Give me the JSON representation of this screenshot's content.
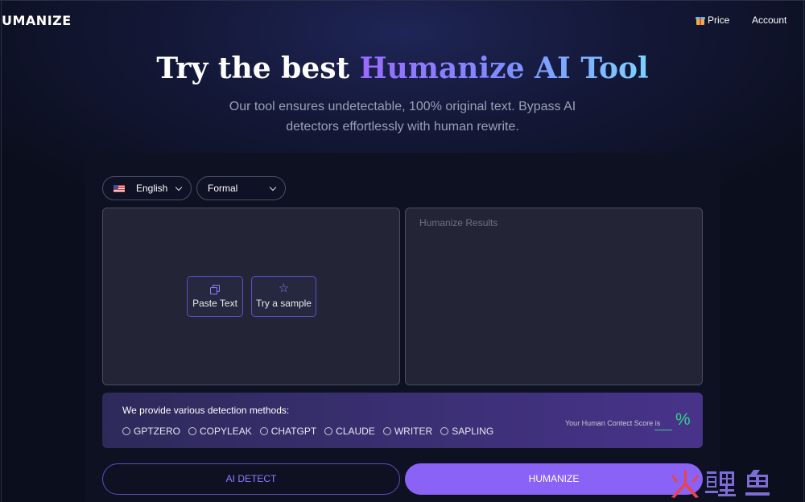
{
  "header": {
    "logo": "UMANIZE",
    "nav": {
      "price": "Price",
      "account": "Account"
    }
  },
  "hero": {
    "title_plain": "Try the best ",
    "title_accent": "Humanize AI Tool",
    "subtitle": "Our tool ensures undetectable, 100% original text. Bypass AI detectors effortlessly with human rewrite."
  },
  "controls": {
    "language": {
      "selected": "English",
      "icon": "us-flag-icon"
    },
    "tone": {
      "selected": "Formal"
    }
  },
  "editor": {
    "paste_label": "Paste Text",
    "sample_label": "Try a sample",
    "results_placeholder": "Humanize Results"
  },
  "detection": {
    "title": "We provide various detection methods:",
    "methods": [
      "GPTZERO",
      "COPYLEAK",
      "CHATGPT",
      "CLAUDE",
      "WRITER",
      "SAPLING"
    ],
    "score_label": "Your Human Contect Score is",
    "score_unit": "%"
  },
  "actions": {
    "detect_label": "AI DETECT",
    "humanize_label": "HUMANIZE"
  },
  "colors": {
    "accent": "#8a63f6",
    "score": "#2fd38a",
    "background": "#0b0e1c"
  },
  "watermark": {
    "text": "火鲤鱼"
  }
}
